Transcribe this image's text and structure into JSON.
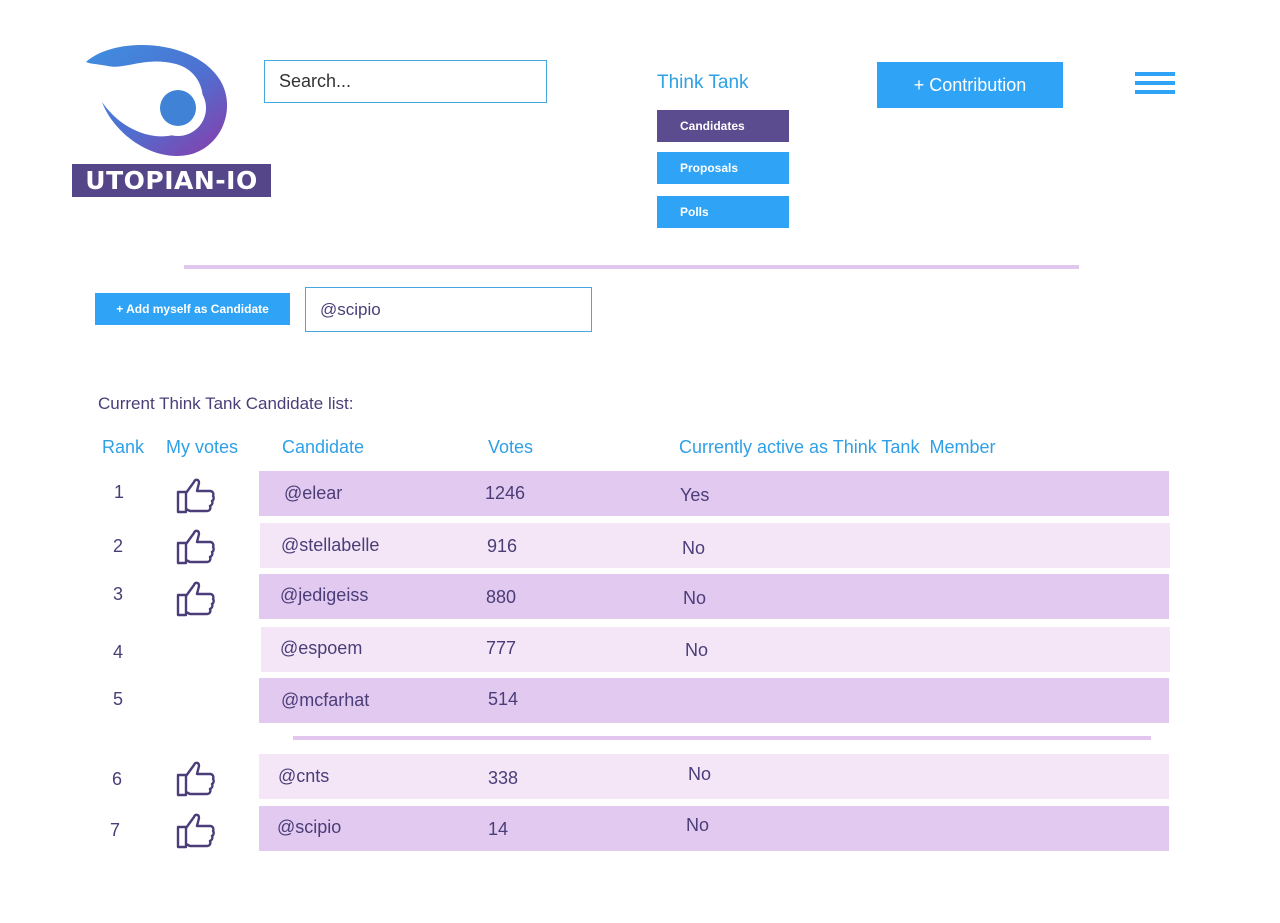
{
  "brand": {
    "name": "UTOPIAN-IO"
  },
  "header": {
    "search_placeholder": "Search...",
    "contribution_label": "+ Contribution"
  },
  "nav": {
    "title": "Think Tank",
    "items": [
      {
        "label": "Candidates",
        "active": true
      },
      {
        "label": "Proposals",
        "active": false
      },
      {
        "label": "Polls",
        "active": false
      }
    ]
  },
  "candidate_form": {
    "add_button_label": "+ Add myself as Candidate",
    "username_value": "@scipio"
  },
  "list": {
    "title": "Current Think Tank Candidate list:",
    "columns": {
      "rank": "Rank",
      "my_votes": "My votes",
      "candidate": "Candidate",
      "votes": "Votes",
      "active": "Currently active as Think Tank  Member"
    },
    "rows": [
      {
        "rank": "1",
        "voted": true,
        "candidate": "@elear",
        "votes": "1246",
        "active": "Yes"
      },
      {
        "rank": "2",
        "voted": true,
        "candidate": "@stellabelle",
        "votes": "916",
        "active": "No"
      },
      {
        "rank": "3",
        "voted": true,
        "candidate": "@jedigeiss",
        "votes": "880",
        "active": "No"
      },
      {
        "rank": "4",
        "voted": false,
        "candidate": "@espoem",
        "votes": "777",
        "active": "No"
      },
      {
        "rank": "5",
        "voted": false,
        "candidate": "@mcfarhat",
        "votes": "514",
        "active": ""
      },
      {
        "rank": "6",
        "voted": true,
        "candidate": "@cnts",
        "votes": "338",
        "active": "No"
      },
      {
        "rank": "7",
        "voted": true,
        "candidate": "@scipio",
        "votes": "14",
        "active": "No"
      }
    ]
  },
  "icons": {
    "vote": "thumbs-up-icon",
    "menu": "hamburger-menu-icon",
    "logo": "eye-logo-icon"
  },
  "colors": {
    "accent_blue": "#2fa3f5",
    "brand_purple": "#55468a",
    "row_dark": "#e2c9ef",
    "row_light": "#f4e6f7",
    "text_purple": "#4a3d78"
  }
}
